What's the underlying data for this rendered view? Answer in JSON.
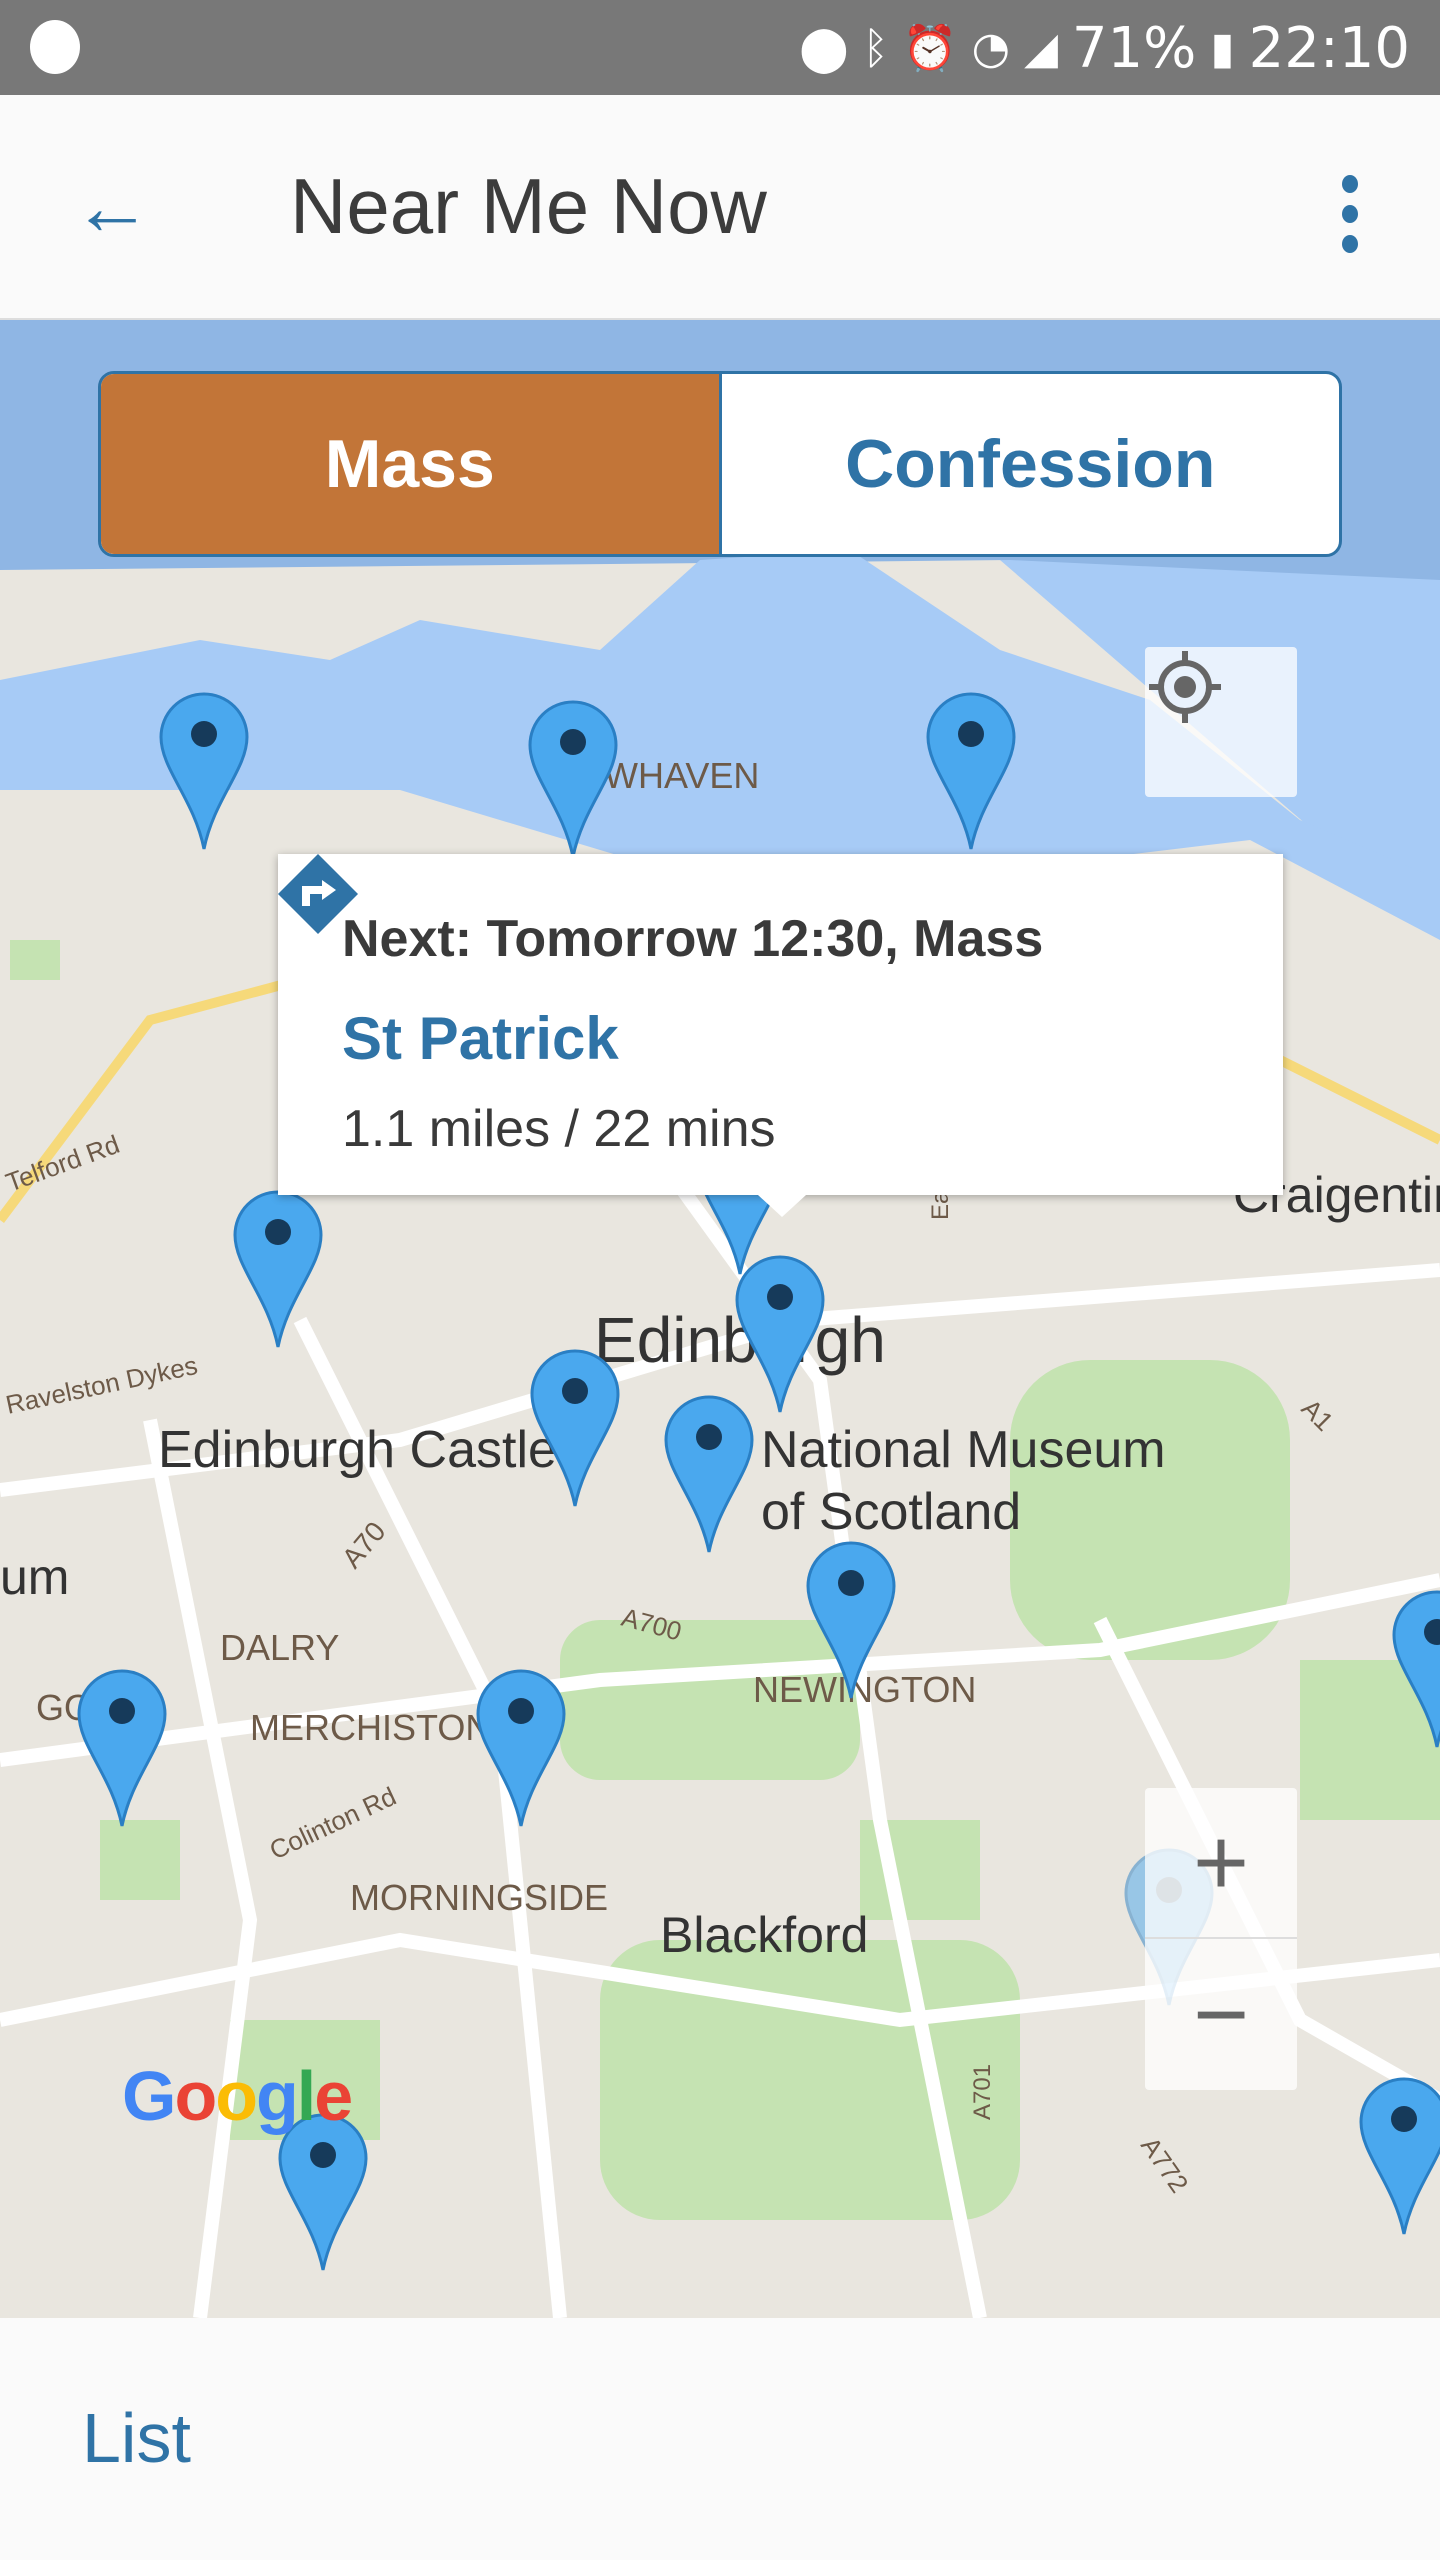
{
  "status_bar": {
    "battery": "71%",
    "time": "22:10",
    "icons": [
      "spotify-icon",
      "location-icon",
      "bluetooth-icon",
      "alarm-icon",
      "wifi-icon",
      "signal-icon",
      "battery-charging-icon"
    ]
  },
  "app_bar": {
    "title": "Near Me Now",
    "back_icon": "arrow-left-icon",
    "menu_icon": "more-vertical-icon"
  },
  "toggle": {
    "options": [
      "Mass",
      "Confession"
    ],
    "selected": "Mass",
    "selected_color": "#c27538",
    "accent": "#2f73a6"
  },
  "popup": {
    "next": "Next: Tomorrow 12:30, Mass",
    "church": "St Patrick",
    "distance": "1.1 miles / 22 mins",
    "directions_icon": "directions-icon"
  },
  "map": {
    "labels": {
      "newhaven": "WHAVEN",
      "craigentinny": "Craigentin",
      "telford": "Telford Rd",
      "ravelston": "Ravelston Dykes",
      "edinburgh": "Edinburgh",
      "castle": "Edinburgh Castle",
      "museum1": "National Museum",
      "museum2": "of Scotland",
      "um": "um",
      "a70": "A70",
      "a700": "A700",
      "dalry": "DALRY",
      "newington": "NEWINGTON",
      "go": "GO",
      "merchiston": "MERCHISTON",
      "colinton": "Colinton Rd",
      "morningside": "MORNINGSIDE",
      "blackford": "Blackford",
      "a701": "A701",
      "a772": "A772",
      "a1": "A1",
      "ea": "Ea"
    },
    "zoom_in": "+",
    "zoom_out": "−",
    "logo": "Google",
    "locate_icon": "my-location-icon"
  },
  "bottom": {
    "list_label": "List"
  }
}
